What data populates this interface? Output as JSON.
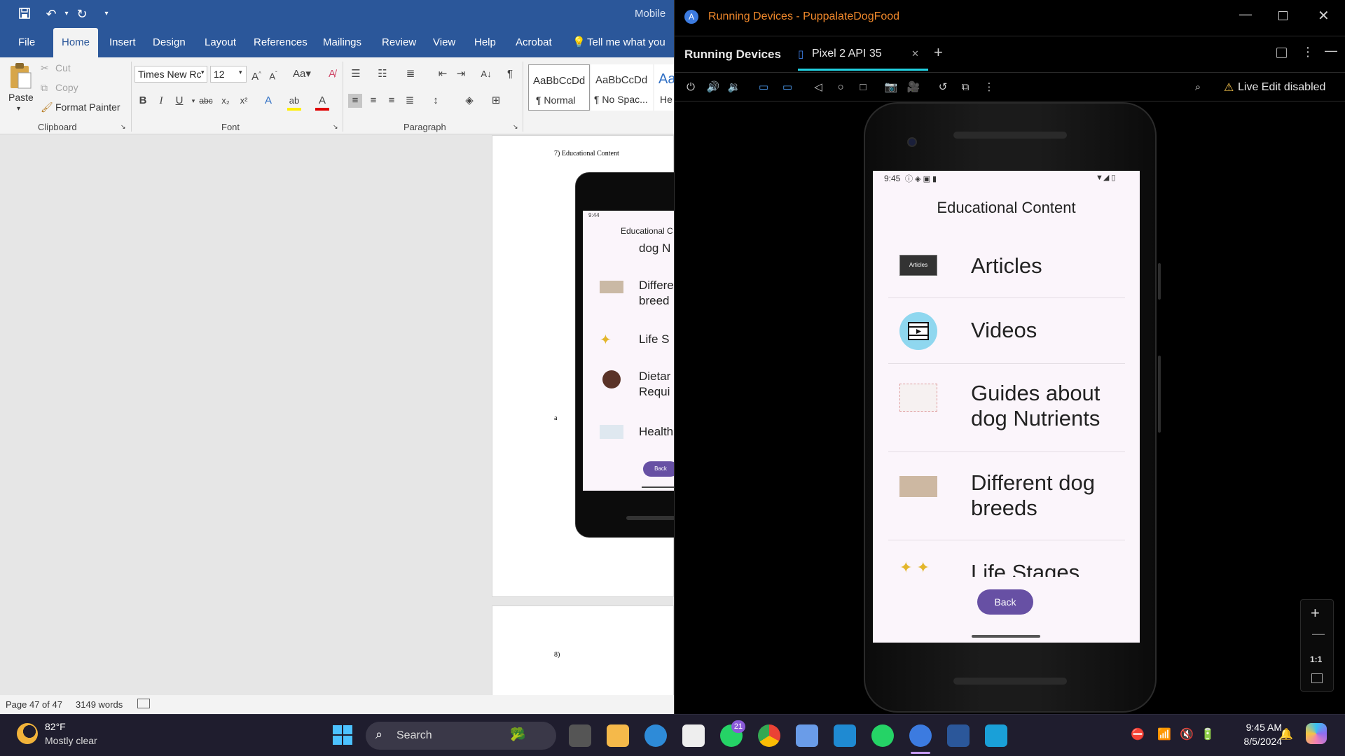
{
  "word": {
    "title_fragment": "Mobile",
    "tabs": [
      "File",
      "Home",
      "Insert",
      "Design",
      "Layout",
      "References",
      "Mailings",
      "Review",
      "View",
      "Help",
      "Acrobat"
    ],
    "active_tab": "Home",
    "tell_me": "Tell me what you w",
    "clipboard": {
      "paste": "Paste",
      "cut": "Cut",
      "copy": "Copy",
      "format_painter": "Format Painter",
      "group": "Clipboard"
    },
    "font": {
      "name": "Times New Rc",
      "size": "12",
      "group": "Font"
    },
    "paragraph": {
      "group": "Paragraph"
    },
    "styles": [
      {
        "sample": "AaBbCcDd",
        "name": "¶ Normal"
      },
      {
        "sample": "AaBbCcDd",
        "name": "¶ No Spac..."
      },
      {
        "sample": "Aa",
        "name": "He"
      }
    ],
    "document": {
      "heading": "7) Educational Content",
      "stray_letter": "a",
      "next_heading": "8)",
      "embedded_phone": {
        "time": "9:44",
        "title": "Educational C",
        "items": [
          "dog N",
          "Differe breed",
          "Life S",
          "Dietar Requi",
          "Health"
        ],
        "back": "Back"
      }
    },
    "status": {
      "page": "Page 47 of 47",
      "words": "3149 words"
    }
  },
  "running_devices": {
    "window_title": "Running Devices - PuppalateDogFood",
    "panel_title": "Running Devices",
    "device_tab": "Pixel 2 API 35",
    "live_edit": "Live Edit disabled",
    "zoom_reset": "1:1",
    "accent": "#21d0e0"
  },
  "app": {
    "status_time": "9:45",
    "title": "Educational Content",
    "items": [
      {
        "label": "Articles",
        "icon": "articles-thumb"
      },
      {
        "label": "Videos",
        "icon": "video-icon"
      },
      {
        "label": "Guides about dog Nutrients",
        "icon": "nutrients-thumb"
      },
      {
        "label": "Different dog breeds",
        "icon": "breeds-thumb"
      },
      {
        "label": "Life Stages",
        "icon": "life-stages-thumb"
      }
    ],
    "back": "Back",
    "back_color": "#6750a4"
  },
  "taskbar": {
    "weather_temp": "82°F",
    "weather_text": "Mostly clear",
    "search": "Search",
    "whatsapp_badge": "21",
    "time": "9:45 AM",
    "date": "8/5/2024"
  }
}
